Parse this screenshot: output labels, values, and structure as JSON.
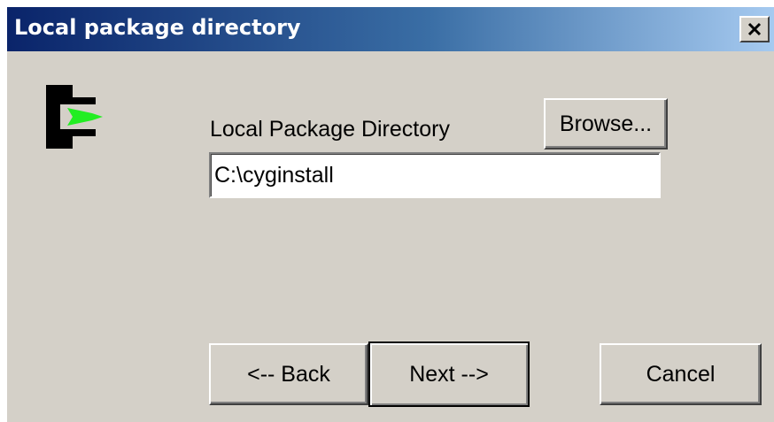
{
  "window": {
    "title": "Local package directory",
    "close_label": "✕"
  },
  "logo": {
    "icon": "cygwin-logo-icon",
    "colors": {
      "bracket": "#000000",
      "arrow": "#22ee22"
    }
  },
  "directory": {
    "label": "Local Package Directory",
    "value": "C:\\cyginstall",
    "browse_label": "Browse..."
  },
  "buttons": {
    "back_label": "<-- Back",
    "next_label": "Next -->",
    "cancel_label": "Cancel"
  },
  "colors": {
    "titlebar_start": "#0a246a",
    "titlebar_end": "#a6caf0",
    "dialog_face": "#d4d0c8"
  }
}
